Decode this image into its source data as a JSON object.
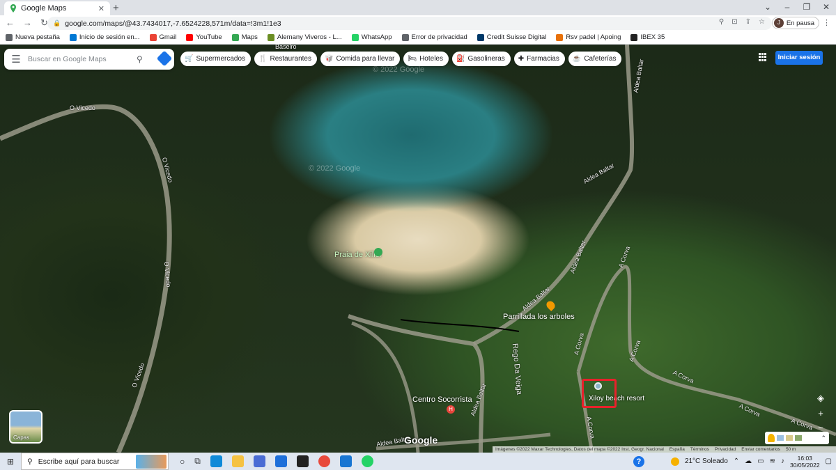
{
  "browser": {
    "tab_title": "Google Maps",
    "url": "google.com/maps/@43.7434017,-7.6524228,571m/data=!3m1!1e3",
    "profile_initial": "J",
    "profile_status": "En pausa",
    "bookmarks": [
      {
        "label": "Nueva pestaña",
        "color": "#5f6368"
      },
      {
        "label": "Inicio de sesión en...",
        "color": "#0078d4"
      },
      {
        "label": "Gmail",
        "color": "#ea4335"
      },
      {
        "label": "YouTube",
        "color": "#ff0000"
      },
      {
        "label": "Maps",
        "color": "#34a853"
      },
      {
        "label": "Alemany Viveros - L...",
        "color": "#6b8e23"
      },
      {
        "label": "WhatsApp",
        "color": "#25d366"
      },
      {
        "label": "Error de privacidad",
        "color": "#5f6368"
      },
      {
        "label": "Credit Suisse Digital",
        "color": "#003868"
      },
      {
        "label": "Rsv padel | Apoing",
        "color": "#e8710a"
      },
      {
        "label": "IBEX 35",
        "color": "#222222"
      }
    ]
  },
  "maps": {
    "search_placeholder": "Buscar en Google Maps",
    "chips": [
      {
        "icon": "🛒",
        "label": "Supermercados"
      },
      {
        "icon": "🍴",
        "label": "Restaurantes"
      },
      {
        "icon": "🥡",
        "label": "Comida para llevar"
      },
      {
        "icon": "🛏",
        "label": "Hoteles"
      },
      {
        "icon": "⛽",
        "label": "Gasolineras"
      },
      {
        "icon": "✚",
        "label": "Farmacias"
      },
      {
        "icon": "☕",
        "label": "Cafeterías"
      }
    ],
    "signin_label": "Iniciar sesión",
    "layers_label": "Capas",
    "google_logo": "Google",
    "watermark": "© 2022 Google",
    "road_labels": {
      "o_vicedo": "O Vicedo",
      "aldea_baltar": "Aldea Baltar",
      "a_corva": "A Corva",
      "rego_da_veiga": "Rego Da Veiga",
      "baselro": "Baselro"
    },
    "pois": {
      "praia": "Praia de Xilloi",
      "parrillada": "Parrillada los arboles",
      "centro": "Centro Socorrista",
      "resort": "Xiloy beach resort"
    },
    "attribution": [
      "Imágenes ©2022 Maxar Technologies, Datos del mapa ©2022 Inst. Geogr. Nacional",
      "España",
      "Términos",
      "Privacidad",
      "Enviar comentarios",
      "50 m"
    ]
  },
  "taskbar": {
    "search_placeholder": "Escribe aquí para buscar",
    "weather": "21°C  Soleado",
    "time": "16:03",
    "date": "30/05/2022"
  }
}
